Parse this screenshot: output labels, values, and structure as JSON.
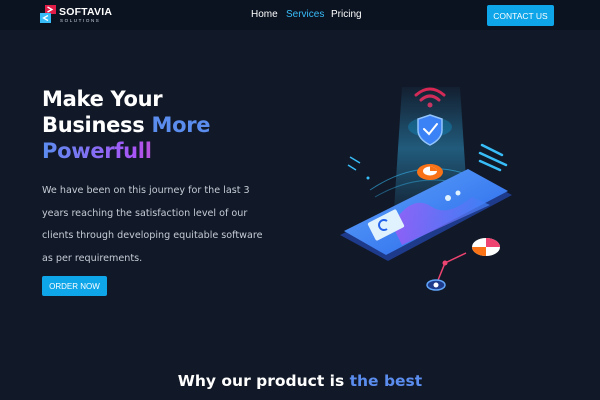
{
  "header": {
    "logo": {
      "name": "SOFTAVIA",
      "tagline": "SOLUTIONS"
    },
    "nav": [
      {
        "label": "Home",
        "active": false
      },
      {
        "label": "Services",
        "active": true
      },
      {
        "label": "Pricing",
        "active": false
      }
    ],
    "cta_label": "CONTACT US"
  },
  "hero": {
    "title_line1": "Make Your",
    "title_line2a": "Business",
    "title_line2b": "More",
    "title_line3": "Powerfull",
    "description": "We have been on this journey for the last 3 years reaching the satisfaction level of our clients through developing equitable software as per requirements.",
    "button_label": "ORDER NOW",
    "illustration": "smartphone-security-illustration"
  },
  "section": {
    "title_part1": "Why our product is",
    "title_part2": "the best"
  },
  "colors": {
    "background": "#111827",
    "header_bg": "#0b1220",
    "accent": "#0ea5e9",
    "active_nav": "#38bdf8",
    "heading_blue": "#5b8def",
    "gradient": [
      "#5b8def",
      "#a855f7",
      "#ef4471"
    ]
  }
}
